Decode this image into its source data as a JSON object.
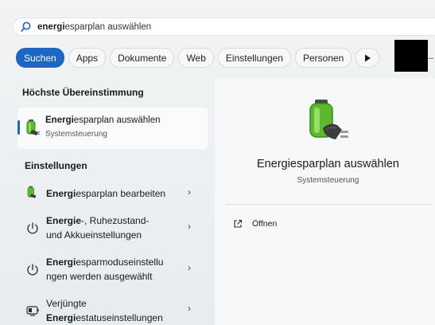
{
  "search": {
    "query_bold": "energi",
    "query_rest": "esparplan auswählen",
    "icon": "search-icon"
  },
  "tabs": [
    {
      "label": "Suchen",
      "active": true
    },
    {
      "label": "Apps"
    },
    {
      "label": "Dokumente"
    },
    {
      "label": "Web"
    },
    {
      "label": "Einstellungen"
    },
    {
      "label": "Personen"
    }
  ],
  "tabs_more_icon": "play-icon",
  "overflow": "...",
  "best_match": {
    "heading": "Höchste Übereinstimmung",
    "title_bold": "Energi",
    "title_rest": "esparplan auswählen",
    "subtitle": "Systemsteuerung",
    "icon": "battery-plug-icon"
  },
  "settings": {
    "heading": "Einstellungen",
    "items": [
      {
        "icon": "battery-plug-icon",
        "line1_bold": "Energi",
        "line1_rest": "esparplan bearbeiten",
        "line2_bold": "",
        "line2_rest": ""
      },
      {
        "icon": "power-icon",
        "line1_bold": "Energie",
        "line1_rest": "-, Ruhezustand-",
        "line2_bold": "",
        "line2_rest": "und Akkueinstellungen"
      },
      {
        "icon": "power-icon",
        "line1_bold": "Energi",
        "line1_rest": "esparmoduseinstellu",
        "line2_bold": "",
        "line2_rest": "ngen werden ausgewählt"
      },
      {
        "icon": "battery-status-icon",
        "line1_bold": "",
        "line1_rest": "Verjüngte",
        "line2_bold": "Energi",
        "line2_rest": "estatuseinstellungen"
      }
    ],
    "chevron": "›"
  },
  "preview": {
    "title": "Energiesparplan auswählen",
    "subtitle": "Systemsteuerung",
    "open_label": "Öffnen",
    "icon": "battery-plug-icon"
  },
  "colors": {
    "accent": "#1f65c4",
    "battery_green": "#5cb82e"
  }
}
